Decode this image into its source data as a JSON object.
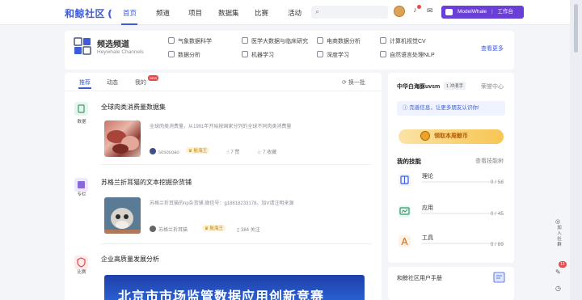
{
  "header": {
    "logo": "和鲸社区",
    "nav": [
      "首页",
      "频道",
      "项目",
      "数据集",
      "比赛",
      "活动"
    ],
    "active_nav": "首页",
    "search_placeholder": "",
    "modelwhale_label": "ModelWhale",
    "workbench_label": "工作台"
  },
  "channels": {
    "title": "频选频道",
    "subtitle": "Heywhale Channels",
    "items": [
      "气象数据科学",
      "医学大数据与临床研究",
      "电商数据分析",
      "计算机视觉CV",
      "数据分析",
      "机器学习",
      "深度学习",
      "自然语言处理NLP"
    ],
    "more": "查看更多"
  },
  "feed": {
    "tabs": [
      "推荐",
      "动态",
      "我的"
    ],
    "new_badge": "NEW",
    "refresh": "换一批",
    "posts": [
      {
        "category": "数据",
        "title": "全球肉类消费量数据集",
        "desc": "全球肉类消费量，从1991年开始按国家分列的全球不同肉类消费量",
        "author": "sososoao",
        "badge": "航海王",
        "likes": "7 赞",
        "stars": "7 收藏"
      },
      {
        "category": "专栏",
        "title": "苏格兰折耳猫的文本挖掘杂货铺",
        "desc": "苏格兰折耳猫的np杂货铺,微信号：g18818233178。加V请注明来源",
        "author": "苏格兰折耳猫",
        "badge": "航海王",
        "follows": "384 关注"
      },
      {
        "category": "比赛",
        "title": "企业高质量发展分析",
        "banner": "北京市市场监管数据应用创新竞赛"
      }
    ]
  },
  "sidebar": {
    "username": "中华白海豚uvsm",
    "level": "冲浪手",
    "level_num": "1",
    "center": "荣誉中心",
    "alert": "完善信息，让更多朋友认识你!",
    "coin_btn": "领取本周鲸币",
    "skills_title": "我的技能",
    "skills_view": "查看技能树",
    "skills": [
      {
        "name": "理论",
        "count": "0 / 58",
        "icon": "book-icon"
      },
      {
        "name": "应用",
        "count": "0 / 45",
        "icon": "chart-icon"
      },
      {
        "name": "工具",
        "count": "0 / 89",
        "icon": "tool-icon"
      }
    ],
    "manual": "和鲸社区用户手册"
  },
  "float": {
    "join": "加入社群",
    "badge": "13"
  },
  "colors": {
    "accent": "#3e5bd8",
    "brand_purple": "#6a3fd8",
    "gold": "#f7c552"
  }
}
